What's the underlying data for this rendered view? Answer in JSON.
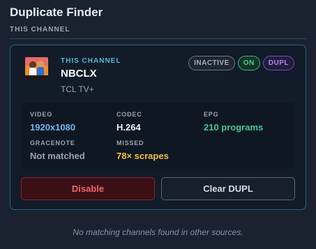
{
  "panel": {
    "title": "Duplicate Finder",
    "section_label": "THIS CHANNEL"
  },
  "channel": {
    "label": "THIS CHANNEL",
    "name": "NBCLX",
    "source": "TCL TV+",
    "logo_icon": "nbclx-logo-icon",
    "badges": {
      "inactive": "INACTIVE",
      "on": "ON",
      "dupl": "DUPL"
    }
  },
  "stats": {
    "video": {
      "label": "VIDEO",
      "value": "1920x1080"
    },
    "codec": {
      "label": "CODEC",
      "value": "H.264"
    },
    "epg": {
      "label": "EPG",
      "value": "210 programs"
    },
    "gracenote": {
      "label": "GRACENOTE",
      "value": "Not matched"
    },
    "missed": {
      "label": "MISSED",
      "value": "78× scrapes"
    }
  },
  "actions": {
    "disable_label": "Disable",
    "clear_dupl_label": "Clear DUPL"
  },
  "empty_message": "No matching channels found in other sources.",
  "colors": {
    "accent": "#4fb6d8",
    "card_border": "#1f6a80",
    "on_green": "#3fd68d",
    "dupl_purple": "#a58cf0",
    "danger": "#f0666e",
    "warning": "#f0c23c"
  }
}
